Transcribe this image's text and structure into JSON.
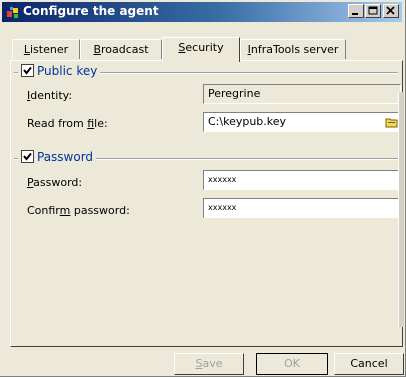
{
  "window": {
    "title": "Configure the agent",
    "icon": "agent-app-icon",
    "controls": [
      "minimize-icon",
      "maximize-icon",
      "close-icon"
    ]
  },
  "tabs": [
    {
      "label": "Listener",
      "mnemonic": "L",
      "rest": "istener",
      "active": false
    },
    {
      "label": "Broadcast",
      "mnemonic": "B",
      "rest": "roadcast",
      "active": false
    },
    {
      "label": "Security",
      "mnemonic": "S",
      "rest": "ecurity",
      "active": true
    },
    {
      "label": "InfraTools server",
      "mnemonic": "I",
      "rest": "nfraTools server",
      "active": false
    }
  ],
  "public_key": {
    "title": "Public key",
    "checked": true,
    "identity_label": "Identity:",
    "identity_value": "Peregrine",
    "read_from_file_label_pre": "Read from ",
    "read_from_file_mnemonic": "f",
    "read_from_file_label_post": "ile:",
    "file_value": "C:\\keypub.key",
    "browse_icon": "folder-icon"
  },
  "password": {
    "title": "Password",
    "checked": true,
    "password_label_mnemonic": "P",
    "password_label_rest": "assword:",
    "password_value": "xxxxxx",
    "confirm_label_pre": "Confir",
    "confirm_label_mnemonic": "m",
    "confirm_label_post": " password:",
    "confirm_value": "xxxxxx"
  },
  "buttons": {
    "save_mnemonic": "S",
    "save_rest": "ave",
    "save_enabled": false,
    "ok_label": "OK",
    "ok_enabled": false,
    "cancel_label": "Cancel"
  },
  "colors": {
    "title_start": "#0a246a",
    "title_end": "#a6caf0",
    "group_title": "#0033a0",
    "face": "#ece9d8"
  }
}
